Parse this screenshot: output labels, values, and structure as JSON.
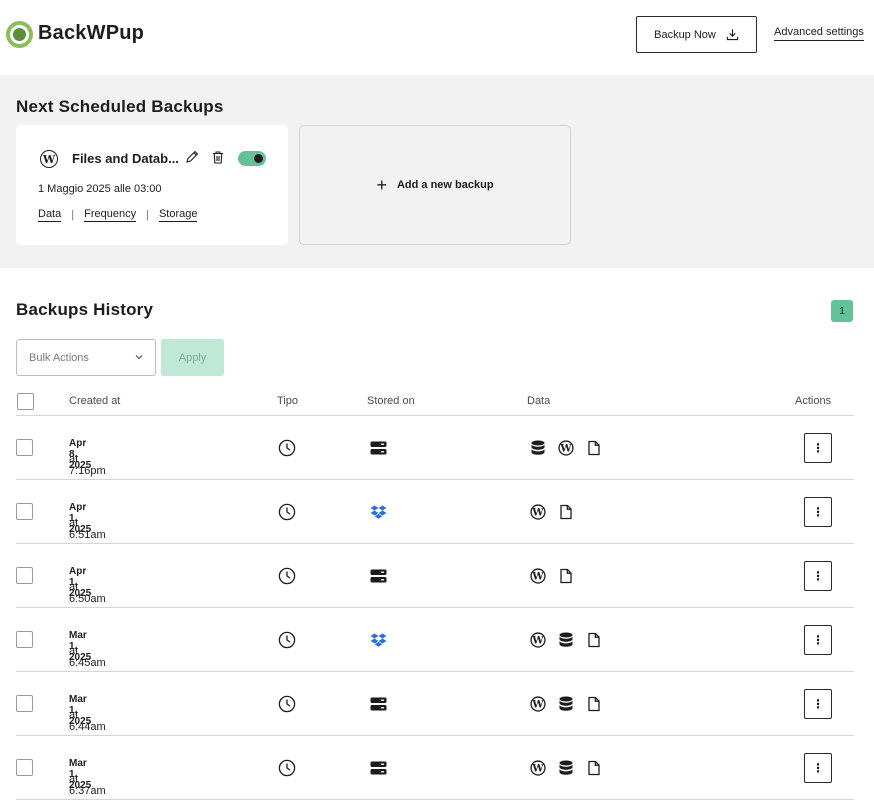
{
  "header": {
    "brand": "BackWPup",
    "backup_now_label": "Backup Now",
    "advanced_settings_label": "Advanced settings"
  },
  "scheduled": {
    "title": "Next Scheduled Backups",
    "card": {
      "title": "Files and Datab...",
      "date": "1 Maggio 2025 alle 03:00",
      "links": [
        "Data",
        "Frequency",
        "Storage"
      ],
      "enabled": true
    },
    "add_label": "Add a new backup"
  },
  "history": {
    "title": "Backups History",
    "page": "1",
    "bulk_actions_placeholder": "Bulk Actions",
    "apply_label": "Apply",
    "columns": {
      "created": "Created at",
      "type": "Tipo",
      "stored": "Stored on",
      "data": "Data",
      "actions": "Actions"
    },
    "rows": [
      {
        "date": "Apr 8, 2025",
        "time": "at 7:16pm",
        "storage": "server-icon",
        "data": [
          "database-icon",
          "wordpress-icon",
          "file-icon"
        ]
      },
      {
        "date": "Apr 1, 2025",
        "time": "at 6:51am",
        "storage": "dropbox-icon",
        "data": [
          "wordpress-icon",
          "file-icon"
        ]
      },
      {
        "date": "Apr 1, 2025",
        "time": "at 6:50am",
        "storage": "server-icon",
        "data": [
          "wordpress-icon",
          "file-icon"
        ]
      },
      {
        "date": "Mar 1, 2025",
        "time": "at 6:45am",
        "storage": "dropbox-icon",
        "data": [
          "wordpress-icon",
          "database-icon",
          "file-icon"
        ]
      },
      {
        "date": "Mar 1, 2025",
        "time": "at 6:44am",
        "storage": "server-icon",
        "data": [
          "wordpress-icon",
          "database-icon",
          "file-icon"
        ]
      },
      {
        "date": "Mar 1, 2025",
        "time": "at 6:37am",
        "storage": "server-icon",
        "data": [
          "wordpress-icon",
          "database-icon",
          "file-icon"
        ]
      }
    ]
  },
  "colors": {
    "accent": "#62c39a",
    "accent_light": "#bfe8d6",
    "section_bg": "#f2f2f2",
    "dropbox": "#2f6fdc"
  }
}
